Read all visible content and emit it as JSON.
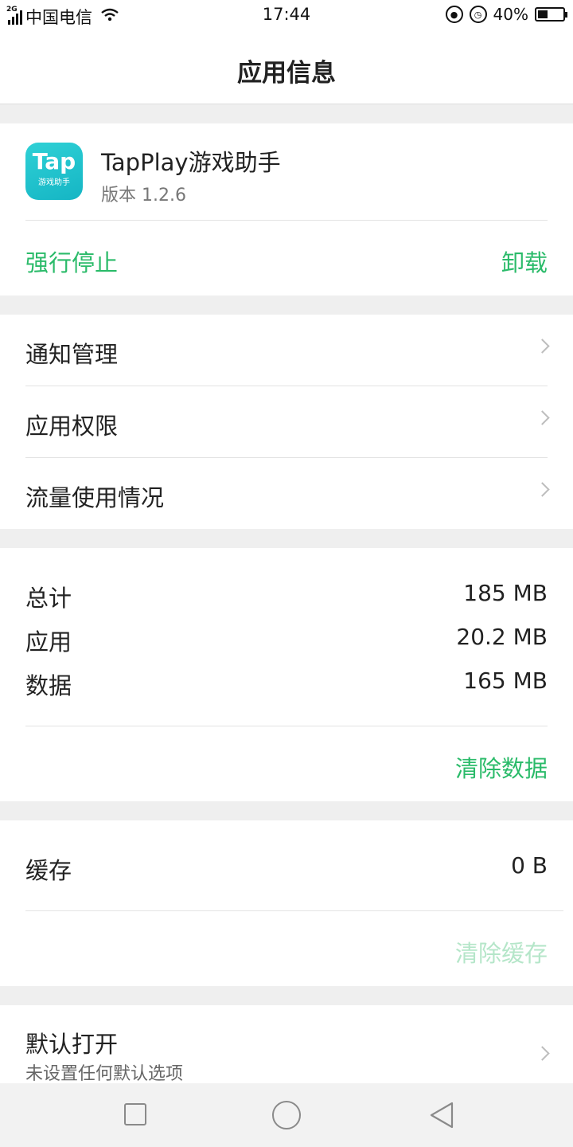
{
  "status_bar": {
    "network": "2G",
    "carrier": "中国电信",
    "time": "17:44",
    "battery_percent_label": "40%",
    "battery_level": 0.4,
    "icons": [
      "signal-icon",
      "wifi-icon",
      "rotation-lock-icon",
      "alarm-icon",
      "battery-icon"
    ]
  },
  "header": {
    "title": "应用信息"
  },
  "app": {
    "icon_text": "Tap",
    "icon_subtext": "游戏助手",
    "name": "TapPlay游戏助手",
    "version": "版本 1.2.6",
    "force_stop_label": "强行停止",
    "uninstall_label": "卸载"
  },
  "settings": [
    {
      "label": "通知管理"
    },
    {
      "label": "应用权限"
    },
    {
      "label": "流量使用情况"
    }
  ],
  "storage": {
    "rows": [
      {
        "key": "总计",
        "value": "185 MB"
      },
      {
        "key": "应用",
        "value": "20.2 MB"
      },
      {
        "key": "数据",
        "value": "165 MB"
      }
    ],
    "clear_data_label": "清除数据"
  },
  "cache": {
    "key": "缓存",
    "value": "0 B",
    "clear_cache_label": "清除缓存"
  },
  "default_open": {
    "title": "默认打开",
    "subtitle": "未设置任何默认选项"
  },
  "colors": {
    "accent": "#2bbb6a",
    "accent_disabled": "#b5e6c9",
    "icon_bg": "#1fc3cf"
  }
}
